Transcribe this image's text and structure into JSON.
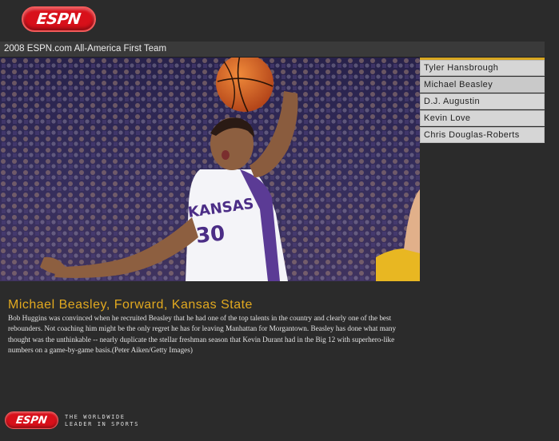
{
  "header": {
    "logo_text": "ESPN"
  },
  "gallery": {
    "title": "2008 ESPN.com All-America First Team",
    "photo_jersey": "KANSAS",
    "photo_number": "30",
    "players": [
      {
        "name": "Tyler Hansbrough"
      },
      {
        "name": "Michael Beasley"
      },
      {
        "name": "D.J. Augustin"
      },
      {
        "name": "Kevin Love"
      },
      {
        "name": "Chris Douglas-Roberts"
      }
    ]
  },
  "caption": {
    "title": "Michael Beasley, Forward, Kansas State",
    "body": "Bob Huggins was convinced when he recruited Beasley that he had one of the top talents in the country and clearly one of the best rebounders. Not coaching him might be the only regret he has for leaving Manhattan for Morgantown. Beasley has done what many thought was the unthinkable -- nearly duplicate the stellar freshman season that Kevin Durant had in the Big 12 with superhero-like numbers on a game-by-game basis.(Peter Aiken/Getty Images)"
  },
  "footer": {
    "logo_text": "ESPN",
    "tagline_line1": "THE WORLDWIDE",
    "tagline_line2": "LEADER IN SPORTS"
  },
  "colors": {
    "background": "#2b2b2b",
    "accent_gold": "#e2a91f",
    "espn_red": "#d8101a",
    "list_bg": "#d6d6d6"
  }
}
